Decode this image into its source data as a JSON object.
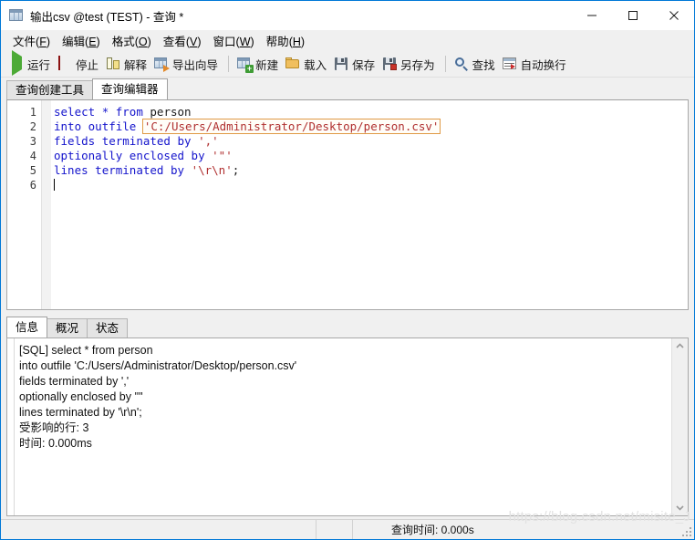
{
  "window": {
    "title": "输出csv @test (TEST) - 查询 *",
    "app_icon": "table-grid-icon",
    "controls": {
      "minimize": "minimize-icon",
      "maximize": "maximize-icon",
      "close": "close-icon"
    }
  },
  "menubar": [
    {
      "label": "文件",
      "accel": "F"
    },
    {
      "label": "编辑",
      "accel": "E"
    },
    {
      "label": "格式",
      "accel": "O"
    },
    {
      "label": "查看",
      "accel": "V"
    },
    {
      "label": "窗口",
      "accel": "W"
    },
    {
      "label": "帮助",
      "accel": "H"
    }
  ],
  "toolbar": [
    {
      "label": "运行",
      "icon": "run-icon"
    },
    {
      "label": "停止",
      "icon": "stop-icon"
    },
    {
      "label": "解释",
      "icon": "explain-icon"
    },
    {
      "label": "导出向导",
      "icon": "export-wizard-icon"
    },
    {
      "separator": true
    },
    {
      "label": "新建",
      "icon": "new-query-icon"
    },
    {
      "label": "载入",
      "icon": "load-folder-icon"
    },
    {
      "label": "保存",
      "icon": "save-icon"
    },
    {
      "label": "另存为",
      "icon": "save-as-icon"
    },
    {
      "separator": true
    },
    {
      "label": "查找",
      "icon": "find-icon"
    },
    {
      "label": "自动换行",
      "icon": "word-wrap-icon"
    }
  ],
  "editor_tabs": [
    {
      "label": "查询创建工具",
      "active": false
    },
    {
      "label": "查询编辑器",
      "active": true
    }
  ],
  "editor": {
    "line_numbers": [
      "1",
      "2",
      "3",
      "4",
      "5",
      "6"
    ],
    "lines": [
      [
        {
          "t": "select",
          "c": "kw"
        },
        {
          "t": " ",
          "c": "op"
        },
        {
          "t": "*",
          "c": "kw"
        },
        {
          "t": " ",
          "c": "op"
        },
        {
          "t": "from",
          "c": "kw"
        },
        {
          "t": " ",
          "c": "op"
        },
        {
          "t": "person",
          "c": "id"
        }
      ],
      [
        {
          "t": "into",
          "c": "kw"
        },
        {
          "t": " ",
          "c": "op"
        },
        {
          "t": "outfile",
          "c": "kw"
        },
        {
          "t": " ",
          "c": "op"
        },
        {
          "t": "'C:/Users/Administrator/Desktop/person.csv'",
          "c": "str",
          "box": true
        }
      ],
      [
        {
          "t": "fields",
          "c": "kw"
        },
        {
          "t": " ",
          "c": "op"
        },
        {
          "t": "terminated",
          "c": "kw"
        },
        {
          "t": " ",
          "c": "op"
        },
        {
          "t": "by",
          "c": "kw"
        },
        {
          "t": " ",
          "c": "op"
        },
        {
          "t": "','",
          "c": "str"
        }
      ],
      [
        {
          "t": "optionally",
          "c": "kw"
        },
        {
          "t": " ",
          "c": "op"
        },
        {
          "t": "enclosed",
          "c": "kw"
        },
        {
          "t": " ",
          "c": "op"
        },
        {
          "t": "by",
          "c": "kw"
        },
        {
          "t": " ",
          "c": "op"
        },
        {
          "t": "'\"'",
          "c": "str"
        }
      ],
      [
        {
          "t": "lines",
          "c": "kw"
        },
        {
          "t": " ",
          "c": "op"
        },
        {
          "t": "terminated",
          "c": "kw"
        },
        {
          "t": " ",
          "c": "op"
        },
        {
          "t": "by",
          "c": "kw"
        },
        {
          "t": " ",
          "c": "op"
        },
        {
          "t": "'\\r\\n'",
          "c": "str"
        },
        {
          "t": ";",
          "c": "op"
        }
      ],
      []
    ]
  },
  "result_tabs": [
    {
      "label": "信息",
      "active": true
    },
    {
      "label": "概况",
      "active": false
    },
    {
      "label": "状态",
      "active": false
    }
  ],
  "log": [
    "[SQL] select * from person",
    "into outfile 'C:/Users/Administrator/Desktop/person.csv'",
    "fields terminated by ','",
    "optionally enclosed by '\"'",
    "lines terminated by '\\r\\n';",
    "受影响的行: 3",
    "时间: 0.000ms"
  ],
  "statusbar": {
    "cell1": "",
    "cell2": "",
    "query_time": "查询时间: 0.000s"
  },
  "watermark": "https://blog.csdn.net/misite_J"
}
